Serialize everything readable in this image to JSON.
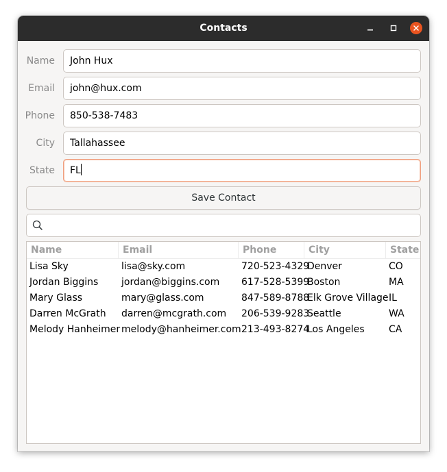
{
  "window": {
    "title": "Contacts"
  },
  "form": {
    "name_label": "Name",
    "name_value": "John Hux",
    "email_label": "Email",
    "email_value": "john@hux.com",
    "phone_label": "Phone",
    "phone_value": "850-538-7483",
    "city_label": "City",
    "city_value": "Tallahassee",
    "state_label": "State",
    "state_value": "FL",
    "save_label": "Save Contact"
  },
  "search": {
    "value": ""
  },
  "table": {
    "columns": [
      "Name",
      "Email",
      "Phone",
      "City",
      "State"
    ],
    "rows": [
      [
        "Lisa Sky",
        "lisa@sky.com",
        "720-523-4329",
        "Denver",
        "CO"
      ],
      [
        "Jordan Biggins",
        "jordan@biggins.com",
        "617-528-5399",
        "Boston",
        "MA"
      ],
      [
        "Mary Glass",
        "mary@glass.com",
        "847-589-8788",
        "Elk Grove Village",
        "IL"
      ],
      [
        "Darren McGrath",
        "darren@mcgrath.com",
        "206-539-9283",
        "Seattle",
        "WA"
      ],
      [
        "Melody Hanheimer",
        "melody@hanheimer.com",
        "213-493-8274",
        "Los Angeles",
        "CA"
      ]
    ]
  },
  "colors": {
    "titlebar": "#2c2c2c",
    "close_button": "#e95420",
    "focus_border": "#f0a080"
  },
  "icons": {
    "minimize": "minimize-icon",
    "maximize": "maximize-icon",
    "close": "close-icon",
    "search": "search-icon"
  }
}
